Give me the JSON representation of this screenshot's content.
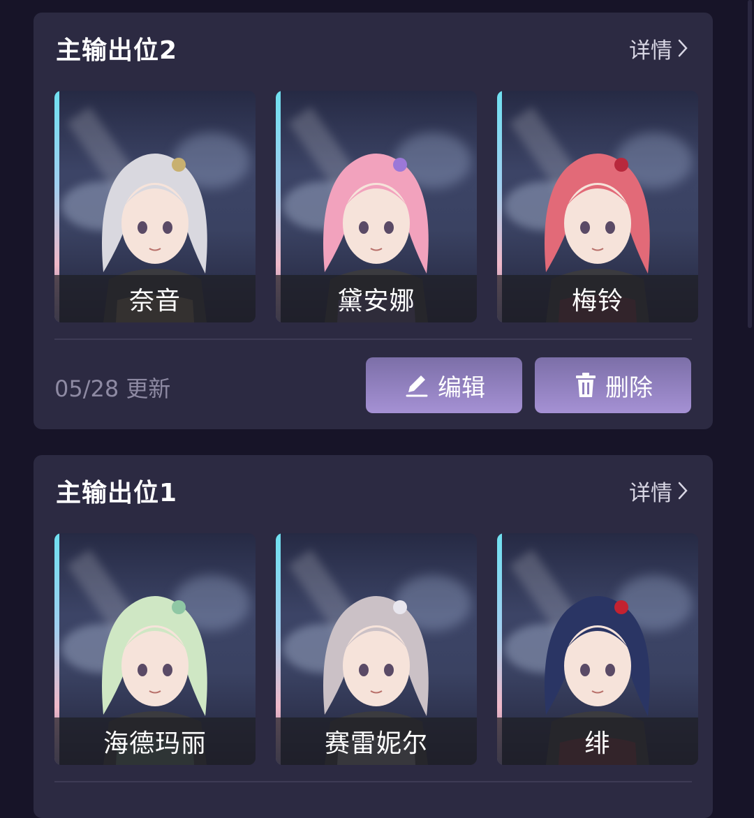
{
  "teams": [
    {
      "title": "主输出位2",
      "details_label": "详情",
      "update_text": "05/28 更新",
      "edit_label": "编辑",
      "delete_label": "删除",
      "members": [
        {
          "name": "奈音",
          "hair": "#d9d8df",
          "accent": "#c8b070"
        },
        {
          "name": "黛安娜",
          "hair": "#f2a2bd",
          "accent": "#9c78d8"
        },
        {
          "name": "梅铃",
          "hair": "#e26a78",
          "accent": "#b8283c"
        }
      ]
    },
    {
      "title": "主输出位1",
      "details_label": "详情",
      "members": [
        {
          "name": "海德玛丽",
          "hair": "#cfe7c4",
          "accent": "#8fc7a4"
        },
        {
          "name": "赛雷妮尔",
          "hair": "#cbc1c6",
          "accent": "#e8e6ee"
        },
        {
          "name": "绯",
          "hair": "#2a3564",
          "accent": "#c42230"
        }
      ]
    }
  ]
}
